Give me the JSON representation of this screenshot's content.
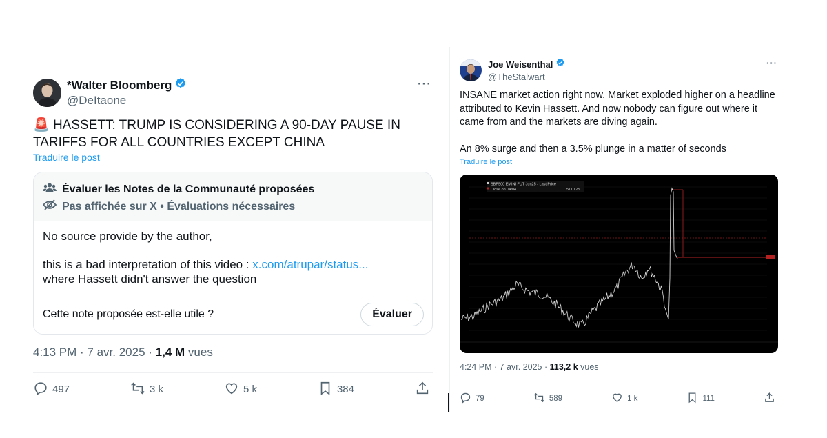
{
  "left_tweet": {
    "display_name": "*Walter Bloomberg",
    "handle": "@DeItaone",
    "text_emoji": "🚨",
    "text": "HASSETT: TRUMP IS CONSIDERING A 90-DAY PAUSE IN TARIFFS FOR ALL COUNTRIES EXCEPT CHINA",
    "translate_label": "Traduire le post",
    "community_note": {
      "title": "Évaluer les Notes de la Communauté proposées",
      "status": "Pas affichée sur X • Évaluations nécessaires",
      "line1": "No source provide by the author,",
      "line2_prefix": "this is a bad interpretation of this video : ",
      "line2_link": "x.com/atrupar/status...",
      "line3": "where Hassett didn't answer the question",
      "question": "Cette note proposée est-elle utile ?",
      "button": "Évaluer"
    },
    "time": "4:13 PM · 7 avr. 2025 · ",
    "views_count": "1,4 M",
    "views_label": " vues",
    "actions": {
      "replies": "497",
      "reposts": "3 k",
      "likes": "5 k",
      "bookmarks": "384"
    }
  },
  "right_tweet": {
    "display_name": "Joe Weisenthal",
    "handle": "@TheStalwart",
    "paragraph1": "INSANE market action right now. Market exploded higher on a headline attributed to Kevin Hassett. And now nobody can figure out where it came from and the markets are diving again.",
    "paragraph2": "An 8% surge and then a 3.5% plunge in a matter of seconds",
    "translate_label": "Traduire le post",
    "chart_legend_title": "SBP500 EMINI FUT Jun25 - Last Price",
    "chart_legend_sub": "Close on 04/04",
    "chart_legend_value": "5110.25",
    "time": "4:24 PM · 7 avr. 2025 · ",
    "views_count": "113,2 k",
    "views_label": " vues",
    "actions": {
      "replies": "79",
      "reposts": "589",
      "likes": "1 k",
      "bookmarks": "111"
    }
  },
  "colors": {
    "accent": "#1d9bf0",
    "verified": "#1d9bf0",
    "alert": "#e0245e",
    "chart_line": "#cfcfcf",
    "chart_bg": "#000000",
    "chart_ref_line": "#b22222"
  }
}
